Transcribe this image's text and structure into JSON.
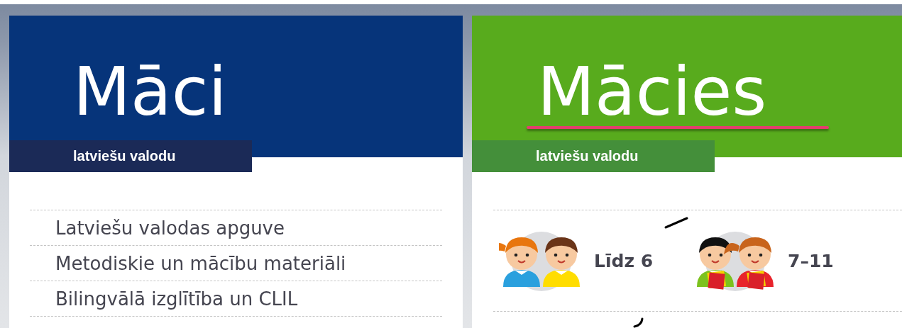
{
  "left_panel": {
    "title": "Māci",
    "subtitle": "latviešu valodu",
    "links": [
      {
        "label": "Latviešu valodas apguve"
      },
      {
        "label": "Metodiskie un mācību materiāli"
      },
      {
        "label": "Bilingvālā izglītība un CLIL"
      }
    ]
  },
  "right_panel": {
    "title": "Mācies",
    "subtitle": "latviešu valodu",
    "age_groups": [
      {
        "label": "Līdz 6",
        "kind": "young"
      },
      {
        "label": "7–11",
        "kind": "readers"
      }
    ]
  }
}
